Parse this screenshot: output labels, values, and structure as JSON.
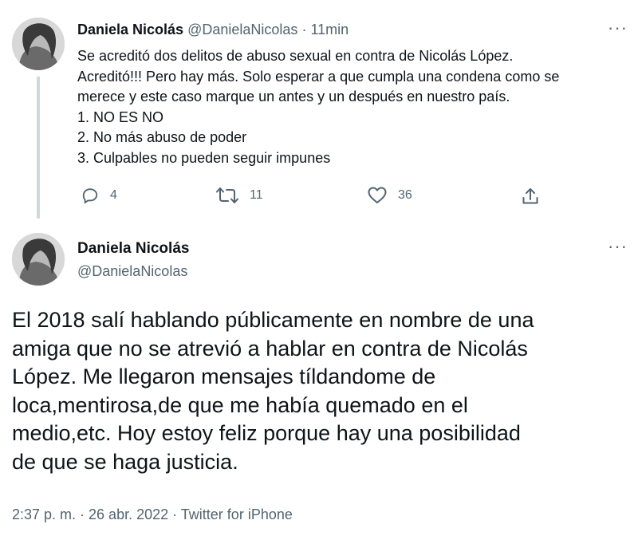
{
  "tweet1": {
    "author_name": "Daniela Nicolás",
    "author_handle": "@DanielaNicolas",
    "separator": "·",
    "time": "11min",
    "more_label": "···",
    "lines": [
      "Se acreditó dos delitos de abuso sexual en contra de Nicolás López.",
      "Acreditó!!! Pero hay más. Solo esperar a que cumpla una condena como se",
      "merece y este caso marque un antes y un después en nuestro país.",
      "1. NO ES NO",
      "2. No más abuso de poder",
      "3. Culpables no pueden seguir impunes"
    ],
    "actions": {
      "replies": "4",
      "retweets": "11",
      "likes": "36"
    }
  },
  "tweet2": {
    "author_name": "Daniela Nicolás",
    "author_handle": "@DanielaNicolas",
    "more_label": "···",
    "lines": [
      "El 2018 salí hablando públicamente en nombre de una",
      "amiga que no se atrevió a hablar en contra de Nicolás",
      "López. Me llegaron mensajes tíldandome de",
      "loca,mentirosa,de que me había quemado en el",
      "medio,etc. Hoy estoy feliz porque hay una posibilidad",
      "de que se haga justicia."
    ],
    "meta": "2:37 p. m. · 26 abr. 2022 · Twitter for iPhone"
  },
  "icons": {
    "reply": "reply-icon",
    "retweet": "retweet-icon",
    "like": "heart-icon",
    "share": "share-icon",
    "more": "more-icon"
  },
  "colors": {
    "text": "#0f1419",
    "secondary": "#536471",
    "thread_line": "#cfd9de"
  }
}
